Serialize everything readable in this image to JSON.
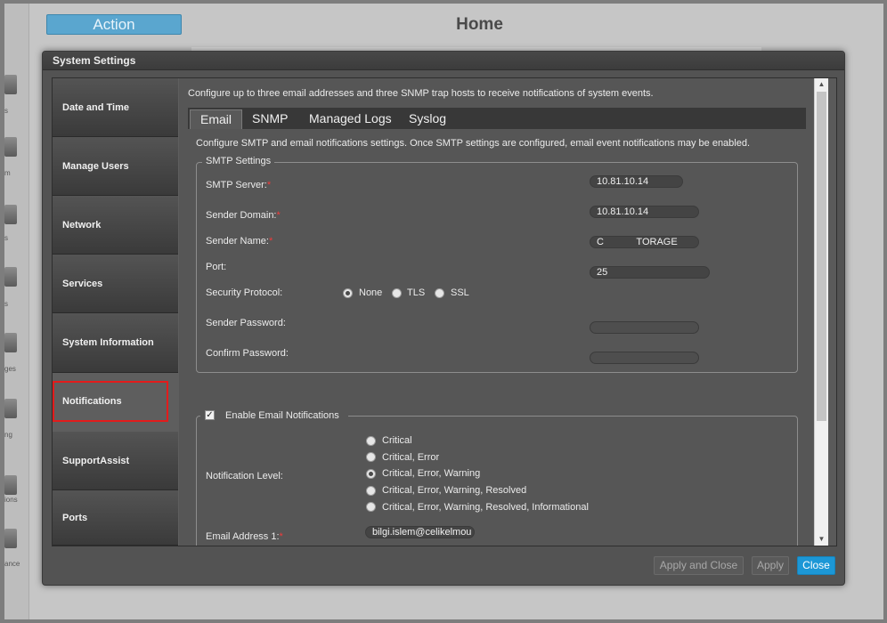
{
  "background": {
    "action_label": "Action",
    "home_title": "Home",
    "rail_labels": [
      "s",
      "m",
      "s",
      "s",
      "ges",
      "ng",
      "ions",
      "ance"
    ]
  },
  "modal": {
    "title": "System Settings",
    "sidebar": {
      "items": [
        {
          "label": "Date and Time"
        },
        {
          "label": "Manage Users"
        },
        {
          "label": "Network"
        },
        {
          "label": "Services"
        },
        {
          "label": "System Information"
        },
        {
          "label": "Notifications",
          "active": true
        },
        {
          "label": "SupportAssist"
        },
        {
          "label": "Ports"
        }
      ]
    },
    "intro": "Configure up to three email addresses and three SNMP trap hosts to receive notifications of system events.",
    "tabs": [
      {
        "label": "Email",
        "active": true
      },
      {
        "label": "SNMP"
      },
      {
        "label": "Managed Logs"
      },
      {
        "label": "Syslog"
      }
    ],
    "email_tab": {
      "description": "Configure SMTP and email notifications settings. Once SMTP settings are configured, email event notifications may be enabled.",
      "smtp": {
        "legend": "SMTP Settings",
        "server_label": "SMTP Server:",
        "server_value": "10.81.10.14",
        "domain_label": "Sender Domain:",
        "domain_value": "10.81.10.14",
        "name_label": "Sender Name:",
        "name_value": "C            TORAGE",
        "port_label": "Port:",
        "port_value": "25",
        "protocol_label": "Security Protocol:",
        "protocol_options": [
          "None",
          "TLS",
          "SSL"
        ],
        "protocol_selected": "None",
        "password_label": "Sender Password:",
        "confirm_label": "Confirm Password:",
        "required_mark": "*"
      },
      "notifications": {
        "enable_label": "Enable Email Notifications",
        "enabled": true,
        "level_label": "Notification Level:",
        "levels": [
          "Critical",
          "Critical, Error",
          "Critical, Error, Warning",
          "Critical, Error, Warning, Resolved",
          "Critical, Error, Warning, Resolved, Informational"
        ],
        "level_selected": "Critical, Error, Warning",
        "email1_label": "Email Address 1:",
        "email1_value": "bilgi.islem@celikelmou"
      }
    },
    "buttons": {
      "apply_close": "Apply and Close",
      "apply": "Apply",
      "close": "Close"
    },
    "colors": {
      "accent": "#1c97d6",
      "active_outline": "#e31b1b",
      "required": "#ef3b3b"
    }
  }
}
